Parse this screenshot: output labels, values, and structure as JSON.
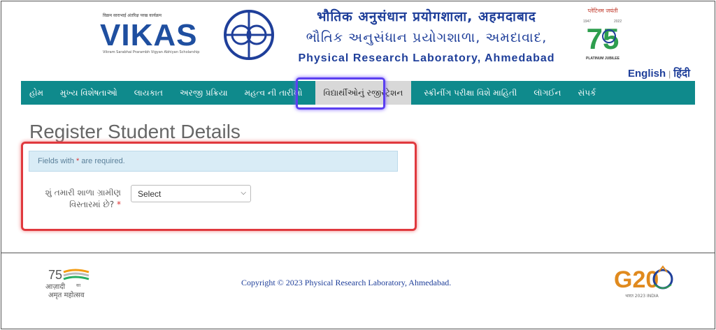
{
  "header": {
    "vikas_logo_text": "VIKAS",
    "vikas_tagline": "विक्रम साराभाई अंतरिक्ष परख कार्यक्रम",
    "vikas_subtitle": "Vikram Sarabhai Prarambh Vigyan Abhiyan Scholarship",
    "title_hindi": "भौतिक अनुसंधान प्रयोगशाला, अहमदाबाद",
    "title_gujarati": "ભૌતિક અનુસંધાન પ્રયોગશાળા, અમદાવાદ,",
    "title_english": "Physical Research Laboratory, Ahmedabad",
    "jubilee_top": "प्लेटिनम जयंती",
    "jubilee_years_left": "1947",
    "jubilee_years_right": "2022",
    "jubilee_number": "75",
    "jubilee_bottom": "PLATINUM JUBILEE"
  },
  "language": {
    "english": "English",
    "hindi": "हिंदी"
  },
  "nav": {
    "items": [
      "હોમ",
      "મુખ્ય વિશેષતાઓ",
      "લાયકાત",
      "અરજી પ્રક્રિયા",
      "મહત્વ ની તારીખો",
      "વિદ્યાર્થીઓનું રજીસ્ટ્રેશન",
      "સ્ક્રીનીંગ પરીક્ષા વિશે માહિતી",
      "લૉગઈન",
      "સંપર્ક"
    ],
    "active_index": 5
  },
  "main": {
    "page_title": "Register Student Details",
    "notice_prefix": "Fields with ",
    "notice_star": "*",
    "notice_suffix": " are required.",
    "field_label": "શું તમારી શાળા ગ્રામીણ વિસ્તારમાં છે?",
    "field_required": "*",
    "select_value": "Select"
  },
  "footer": {
    "azadi_number": "75",
    "azadi_line1": "आज़ादी",
    "azadi_ka": "का",
    "azadi_line2": "अमृत महोत्सव",
    "copyright": "Copyright © 2023 Physical Research Laboratory, Ahmedabad.",
    "g20_text": "G20",
    "g20_caption": "भारत 2023 INDIA"
  },
  "colors": {
    "nav_bg": "#0f8a8c",
    "brand_blue": "#1f3f9a",
    "highlight_red": "#e0393e",
    "highlight_purple": "#5b3ff0"
  }
}
